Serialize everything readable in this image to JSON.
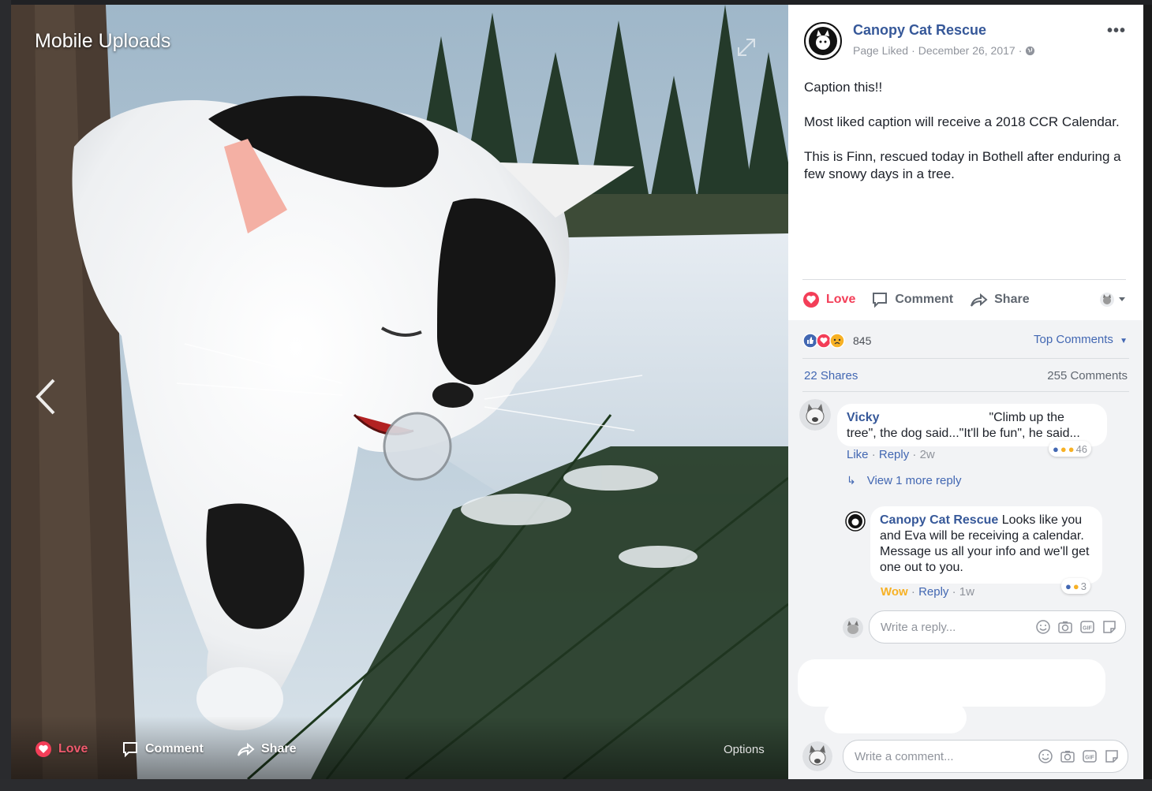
{
  "album_title": "Mobile Uploads",
  "photo_actions": {
    "love": "Love",
    "comment": "Comment",
    "share": "Share",
    "options": "Options"
  },
  "post": {
    "page_name": "Canopy Cat Rescue",
    "page_liked": "Page Liked",
    "date": "December 26, 2017",
    "avatar_text_top": "CANOPY CAT",
    "avatar_text_bottom": "RESCUE",
    "paragraphs": [
      "Caption this!!",
      "Most liked caption will receive a 2018 CCR Calendar.",
      "This is Finn, rescued today in Bothell after enduring a few snowy days in a tree."
    ],
    "icons": {
      "privacy": "globe-icon",
      "menu": "more-dots-icon"
    }
  },
  "actions": {
    "love": "Love",
    "comment": "Comment",
    "share": "Share"
  },
  "reactions": {
    "count": "845",
    "types": [
      "like",
      "love",
      "sad"
    ],
    "sort": "Top Comments"
  },
  "stats": {
    "shares": "22 Shares",
    "comments": "255 Comments"
  },
  "comments": [
    {
      "author": "Vicky",
      "text": "\"Climb up the tree\", the dog said...\"It'll be fun\", he said...",
      "like": "Like",
      "reply": "Reply",
      "time": "2w",
      "reaction_count": "46",
      "view_more": "View 1 more reply"
    }
  ],
  "reply": {
    "author": "Canopy Cat Rescue",
    "text": "Looks like you and Eva will be receiving a calendar. Message us all your info and we'll get one out to you.",
    "reaction_label": "Wow",
    "reply": "Reply",
    "time": "1w",
    "reaction_count": "3"
  },
  "reply_placeholder": "Write a reply...",
  "comment_placeholder": "Write a comment...",
  "colors": {
    "link": "#365899",
    "accent": "#4267b2",
    "love": "#f33e58",
    "wow": "#f7b125"
  }
}
